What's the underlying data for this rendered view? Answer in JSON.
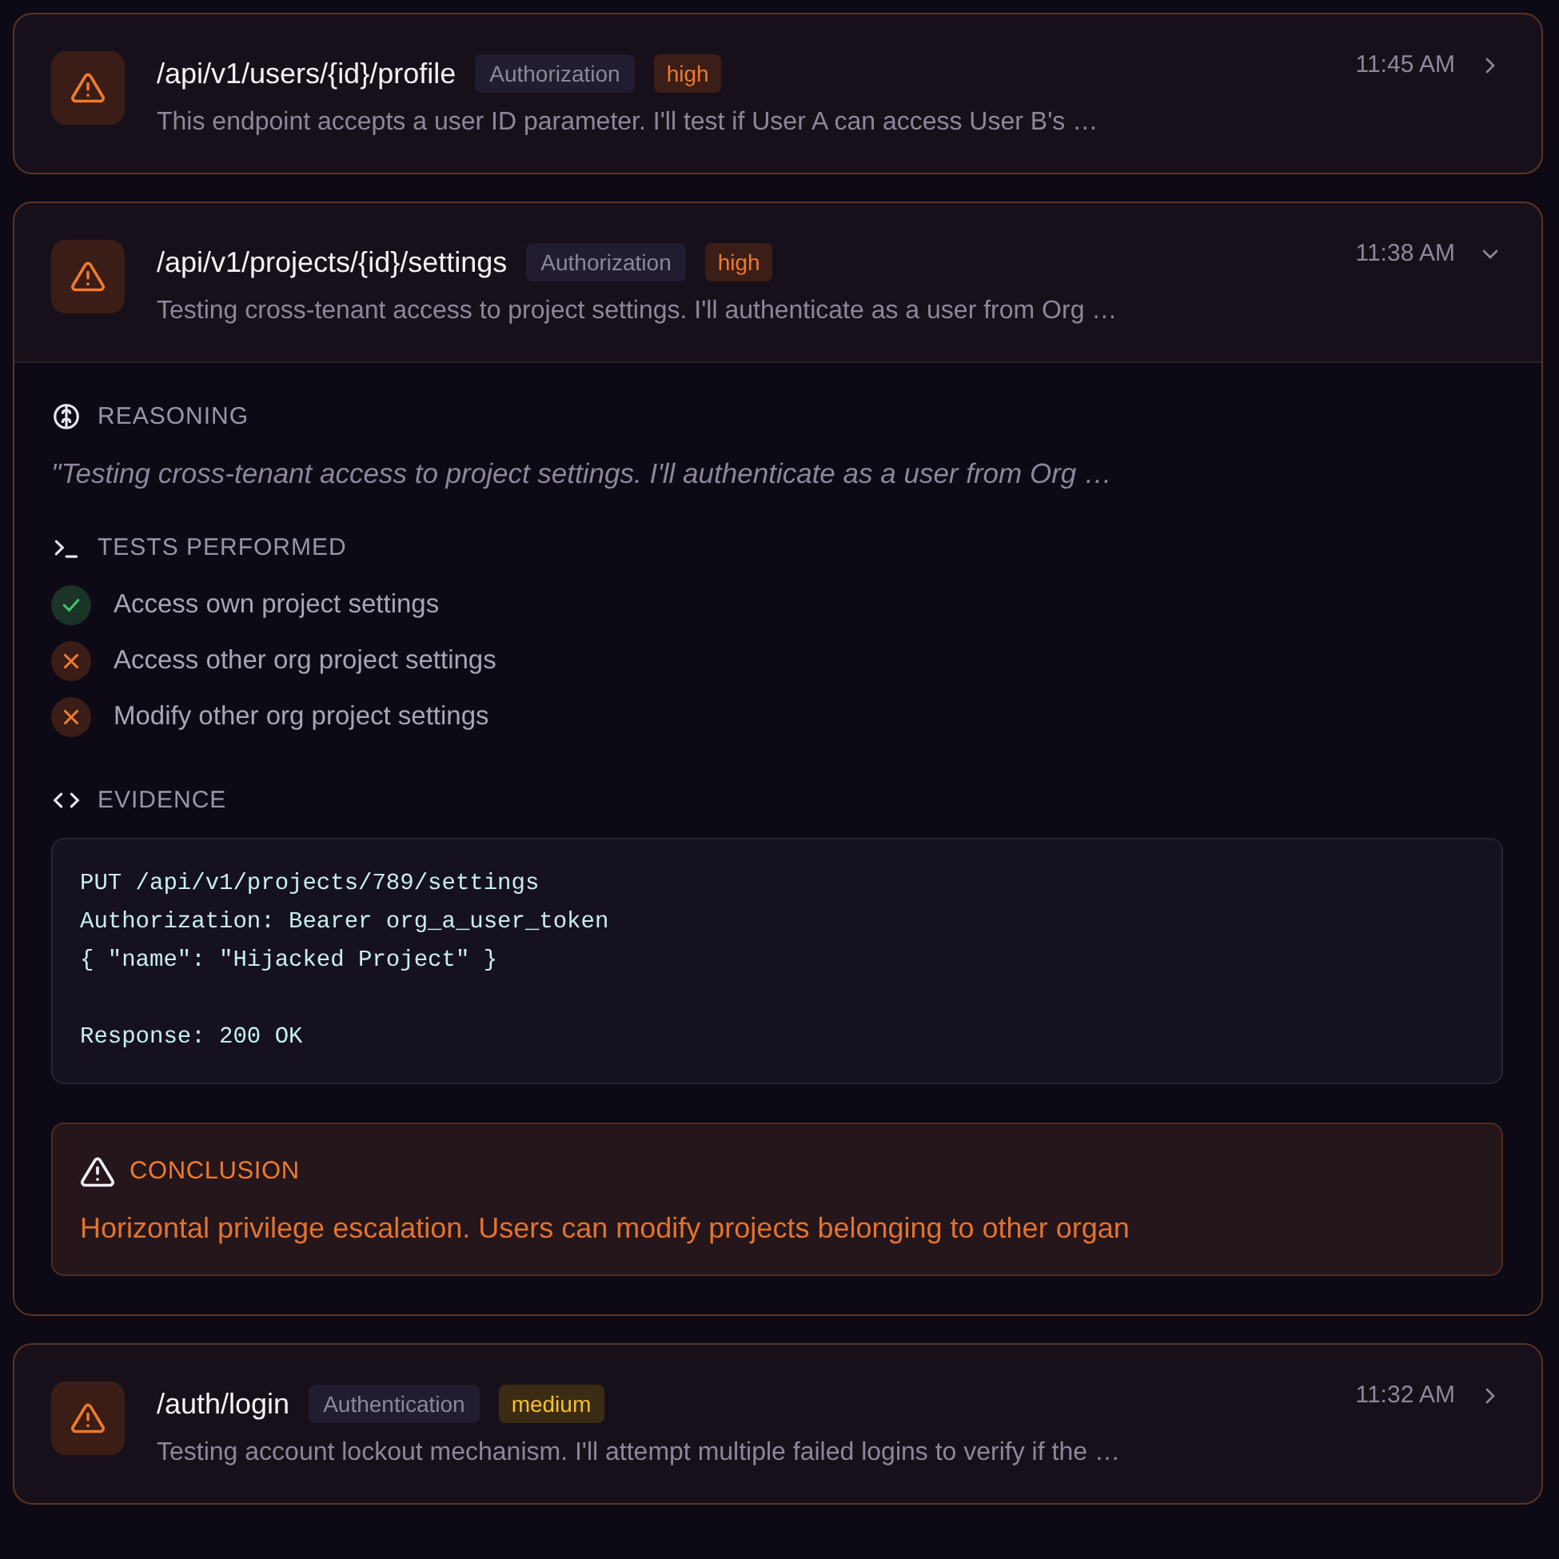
{
  "findings": [
    {
      "endpoint": "/api/v1/users/{id}/profile",
      "category": "Authorization",
      "severity": {
        "text": "high",
        "kind": "high"
      },
      "time": "11:45 AM",
      "summary": "This endpoint accepts a user ID parameter. I'll test if User A can access User B's …",
      "expanded": false
    },
    {
      "endpoint": "/api/v1/projects/{id}/settings",
      "category": "Authorization",
      "severity": {
        "text": "high",
        "kind": "high"
      },
      "time": "11:38 AM",
      "summary": "Testing cross-tenant access to project settings. I'll authenticate as a user from Org …",
      "expanded": true,
      "details": {
        "reasoning_title": "REASONING",
        "reasoning": "\"Testing cross-tenant access to project settings. I'll authenticate as a user from Org …",
        "tests_title": "TESTS PERFORMED",
        "tests": [
          {
            "label": "Access own project settings",
            "passed": true
          },
          {
            "label": "Access other org project settings",
            "passed": false
          },
          {
            "label": "Modify other org project settings",
            "passed": false
          }
        ],
        "evidence_title": "EVIDENCE",
        "evidence_blocks": [
          {
            "lines": [
              "PUT /api/v1/projects/789/settings",
              "Authorization: Bearer org_a_user_token",
              "{ \"name\": \"Hijacked Project\" }"
            ]
          },
          {
            "lines": [
              "Response: 200 OK"
            ]
          }
        ],
        "conclusion_title": "CONCLUSION",
        "conclusion": "Horizontal privilege escalation. Users can modify projects belonging to other organ"
      }
    },
    {
      "endpoint": "/auth/login",
      "category": "Authentication",
      "severity": {
        "text": "medium",
        "kind": "medium"
      },
      "time": "11:32 AM",
      "summary": "Testing account lockout mechanism. I'll attempt multiple failed logins to verify if the …",
      "expanded": false
    }
  ]
}
